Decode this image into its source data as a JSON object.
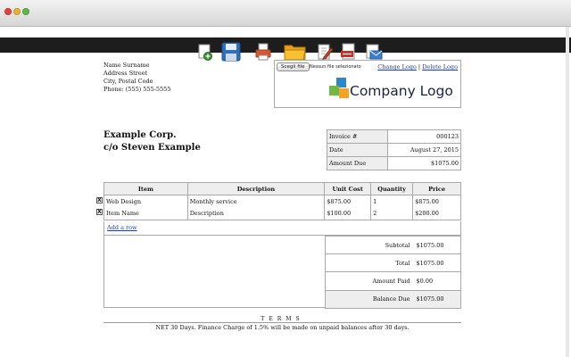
{
  "window": {
    "controls": [
      "close",
      "minimize",
      "zoom"
    ]
  },
  "toolbar": {
    "icons": [
      "new-invoice-icon",
      "save-icon",
      "print-icon",
      "open-folder-icon",
      "edit-icon",
      "export-pdf-icon",
      "email-icon"
    ]
  },
  "seller": {
    "name": "Name Surname",
    "street": "Address Street",
    "city": "City, Postal Code",
    "phone": "Phone: (555) 555-5555"
  },
  "logo": {
    "choose_file_label": "Scegli file",
    "file_status": "Nessun file selezionato",
    "change_label": "Change Logo",
    "separator": "|",
    "delete_label": "Delete Logo",
    "company_text": "Company Logo",
    "colors": {
      "blue": "#2e86c7",
      "green": "#70b744",
      "orange": "#f4a322",
      "text": "#1b2340"
    }
  },
  "customer": {
    "line1": "Example Corp.",
    "line2": "c/o Steven Example"
  },
  "invoice_meta": [
    {
      "label": "Invoice #",
      "value": "000123"
    },
    {
      "label": "Date",
      "value": "August 27, 2015"
    },
    {
      "label": "Amount Due",
      "value": "$1075.00"
    }
  ],
  "items": {
    "headers": {
      "item": "Item",
      "description": "Description",
      "unit_cost": "Unit Cost",
      "quantity": "Quantity",
      "price": "Price"
    },
    "rows": [
      {
        "item": "Web Design",
        "description": "Monthly service",
        "unit_cost": "$875.00",
        "quantity": "1",
        "price": "$875.00"
      },
      {
        "item": "Item Name",
        "description": "Description",
        "unit_cost": "$100.00",
        "quantity": "2",
        "price": "$200.00"
      }
    ],
    "delete_glyph": "X",
    "add_row_label": "Add a row"
  },
  "totals": [
    {
      "label": "Subtotal",
      "value": "$1075.00"
    },
    {
      "label": "Total",
      "value": "$1075.00"
    },
    {
      "label": "Amount Paid",
      "value": "$0.00"
    },
    {
      "label": "Balance Due",
      "value": "$1075.00"
    }
  ],
  "terms": {
    "title": "TERMS",
    "text": "NET 30 Days. Finance Charge of 1.5% will be made on unpaid balances after 30 days."
  }
}
